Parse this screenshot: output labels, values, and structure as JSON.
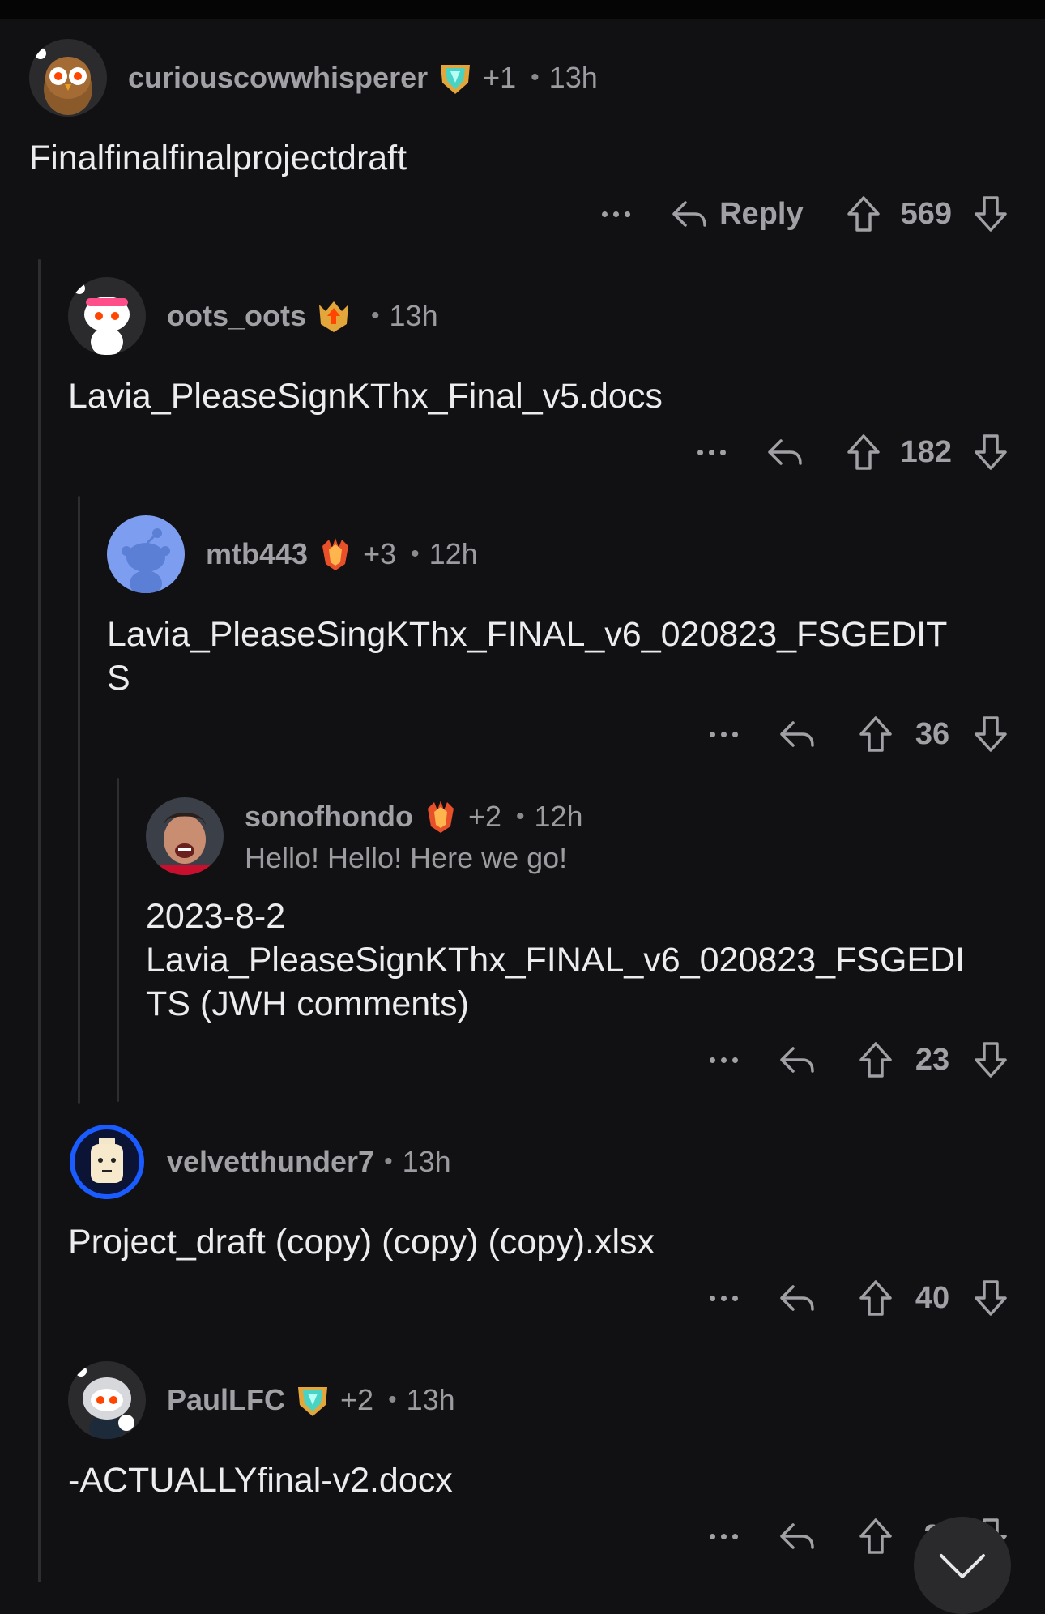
{
  "comments": [
    {
      "username": "curiouscowwhisperer",
      "plus": "+1",
      "time": "13h",
      "body": "Finalfinalfinalprojectdraft",
      "reply_label": "Reply",
      "score": "569",
      "flair_icon": "gem-shield-icon",
      "avatar_icon": "owl-snoo-avatar"
    },
    {
      "username": "oots_oots",
      "plus": "",
      "time": "13h",
      "body": "Lavia_PleaseSignKThx_Final_v5.docs",
      "reply_label": "",
      "score": "182",
      "flair_icon": "crown-arrow-shield-icon",
      "avatar_icon": "pink-headband-snoo-avatar"
    },
    {
      "username": "mtb443",
      "plus": "+3",
      "time": "12h",
      "body": "Lavia_PleaseSingKThx_FINAL_v6_020823_FSGEDIT\nS",
      "reply_label": "",
      "score": "36",
      "flair_icon": "red-crystal-icon",
      "avatar_icon": "default-blue-snoo-avatar"
    },
    {
      "username": "sonofhondo",
      "plus": "+2",
      "time": "12h",
      "user_flair": "Hello! Hello! Here we go!",
      "body": "2023-8-2\nLavia_PleaseSignKThx_FINAL_v6_020823_FSGEDI\nTS (JWH comments)",
      "reply_label": "",
      "score": "23",
      "flair_icon": "red-crystal-icon",
      "avatar_icon": "photo-face-avatar"
    },
    {
      "username": "velvetthunder7",
      "plus": "",
      "time": "13h",
      "body": "Project_draft (copy) (copy) (copy).xlsx",
      "reply_label": "",
      "score": "40",
      "flair_icon": "",
      "avatar_icon": "lego-head-avatar"
    },
    {
      "username": "PaulLFC",
      "plus": "+2",
      "time": "13h",
      "body": "-ACTUALLYfinal-v2.docx",
      "reply_label": "",
      "score": "2",
      "flair_icon": "gem-shield-icon",
      "avatar_icon": "robot-helmet-snoo-avatar"
    }
  ],
  "separator": "•",
  "colors": {
    "background": "#111113",
    "text": "#ececee",
    "muted": "#9b9ba0",
    "thread_line": "#2e2e31",
    "default_avatar": "#7d9ef0"
  }
}
